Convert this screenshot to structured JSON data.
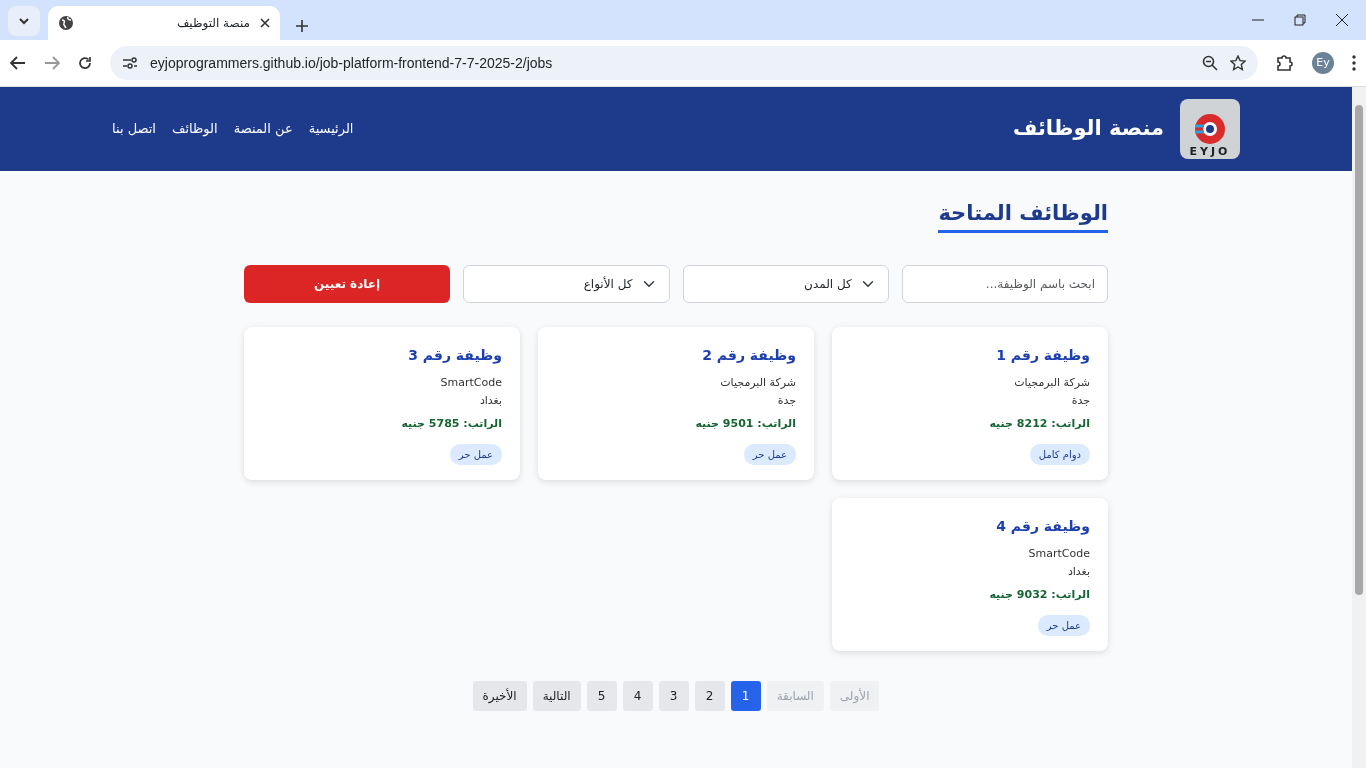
{
  "browser": {
    "tab_title": "منصة التوظيف",
    "url": "eyjoprogrammers.github.io/job-platform-frontend-7-7-2025-2/jobs",
    "profile": "Ey"
  },
  "header": {
    "logo_text": "EYJO",
    "site_title": "منصة الوظائف",
    "nav": [
      "الرئيسية",
      "عن المنصة",
      "الوظائف",
      "اتصل بنا"
    ]
  },
  "page_title": "الوظائف المتاحة",
  "filters": {
    "search": {
      "placeholder": "ابحث باسم الوظيفة..."
    },
    "city": {
      "value": "كل المدن"
    },
    "type": {
      "value": "كل الأنواع"
    },
    "reset_button": "إعادة تعيين"
  },
  "jobs": [
    {
      "title": "وظيفة رقم 1",
      "company": "شركة البرمجيات",
      "city": "جدة",
      "salary": "الراتب: 8212 جنيه",
      "type": "دوام كامل"
    },
    {
      "title": "وظيفة رقم 2",
      "company": "شركة البرمجيات",
      "city": "جدة",
      "salary": "الراتب: 9501 جنيه",
      "type": "عمل حر"
    },
    {
      "title": "وظيفة رقم 3",
      "company": "SmartCode",
      "city": "بغداد",
      "salary": "الراتب: 5785 جنيه",
      "type": "عمل حر"
    },
    {
      "title": "وظيفة رقم 4",
      "company": "SmartCode",
      "city": "بغداد",
      "salary": "الراتب: 9032 جنيه",
      "type": "عمل حر"
    }
  ],
  "pagination": [
    {
      "label": "الأولى",
      "disabled": true,
      "selected": false
    },
    {
      "label": "السابقة",
      "disabled": true,
      "selected": false
    },
    {
      "label": "1",
      "disabled": false,
      "selected": true
    },
    {
      "label": "2",
      "disabled": false,
      "selected": false
    },
    {
      "label": "3",
      "disabled": false,
      "selected": false
    },
    {
      "label": "4",
      "disabled": false,
      "selected": false
    },
    {
      "label": "5",
      "disabled": false,
      "selected": false
    },
    {
      "label": "التالية",
      "disabled": false,
      "selected": false
    },
    {
      "label": "الأخيرة",
      "disabled": false,
      "selected": false
    }
  ]
}
